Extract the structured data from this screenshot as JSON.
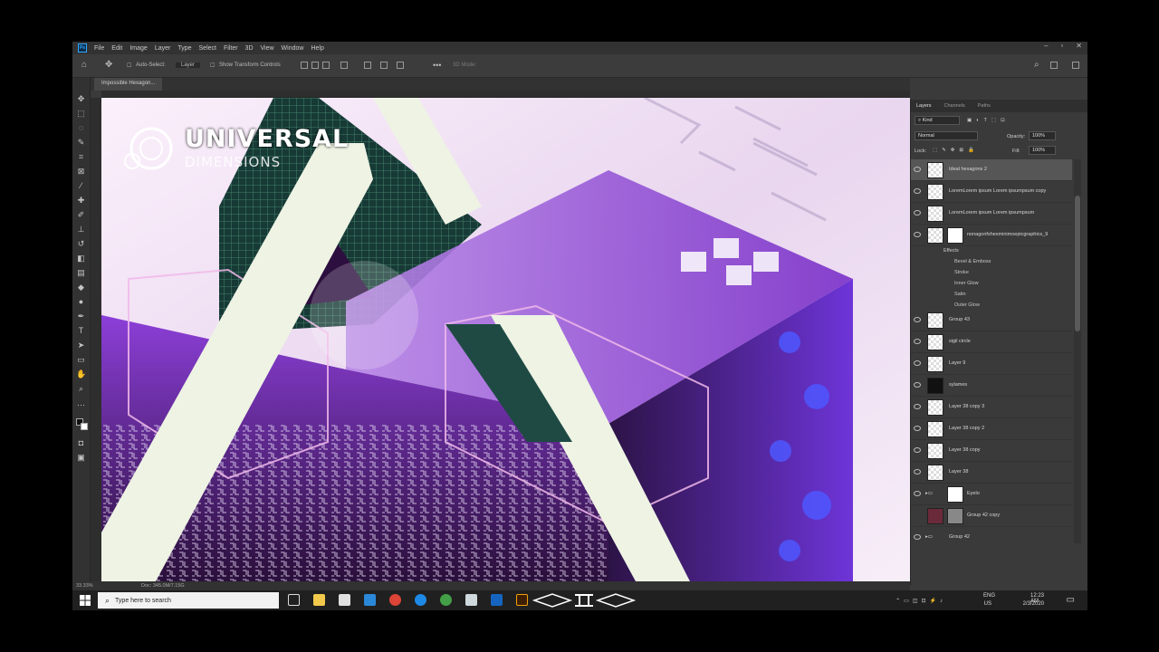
{
  "menu": {
    "app_icon": "Ps",
    "items": [
      "File",
      "Edit",
      "Image",
      "Layer",
      "Type",
      "Select",
      "Filter",
      "3D",
      "View",
      "Window",
      "Help"
    ]
  },
  "options_bar": {
    "auto_select_label": "Auto-Select:",
    "auto_select_value": "Layer",
    "transform_label": "Show Transform Controls",
    "mode_label": "3D Mode:"
  },
  "document": {
    "tab_title": "Impossible Hexagon..."
  },
  "watermark": {
    "title": "UNIVERSAL",
    "subtitle": "DIMENSIONS"
  },
  "layers_panel": {
    "tabs": [
      "Layers",
      "Channels",
      "Paths"
    ],
    "filter_kind": "Kind",
    "blend_mode": "Normal",
    "opacity_label": "Opacity:",
    "opacity_value": "100%",
    "lock_label": "Lock:",
    "fill_label": "Fill:",
    "fill_value": "100%",
    "layers": [
      {
        "name": "Ideal hexagons 2",
        "selected": true
      },
      {
        "name": "LoremLorem ipsum Lorem ipsumpsum copy"
      },
      {
        "name": "LoremLorem ipsum Lorem ipsumpsum"
      },
      {
        "name": "nonagonfxhexminimoepicgraphics_9"
      },
      {
        "name": "Effects",
        "effects": [
          "Bevel & Emboss",
          "Stroke",
          "Inner Glow",
          "Satin",
          "Outer Glow"
        ]
      },
      {
        "name": "Group 43"
      },
      {
        "name": "sigil circle"
      },
      {
        "name": "Layer 9"
      },
      {
        "name": "sylames"
      },
      {
        "name": "Layer 38 copy 3"
      },
      {
        "name": "Layer 38 copy 2"
      },
      {
        "name": "Layer 38 copy"
      },
      {
        "name": "Layer 38"
      },
      {
        "name": "Eyelo"
      },
      {
        "name": "Group 42 copy"
      },
      {
        "name": "Group 42"
      }
    ]
  },
  "status": {
    "zoom": "33.33%",
    "doc_info": "Doc: 345.0M/7.15G"
  },
  "taskbar": {
    "search_placeholder": "Type here to search",
    "language": "ENG",
    "region": "US",
    "time": "12:23 AM",
    "date": "2/3/2020"
  },
  "colors": {
    "ps_blue": "#31a8ff",
    "purple": "#8a2bd6",
    "teal": "#1f4a44",
    "pale": "#eef2e4"
  }
}
